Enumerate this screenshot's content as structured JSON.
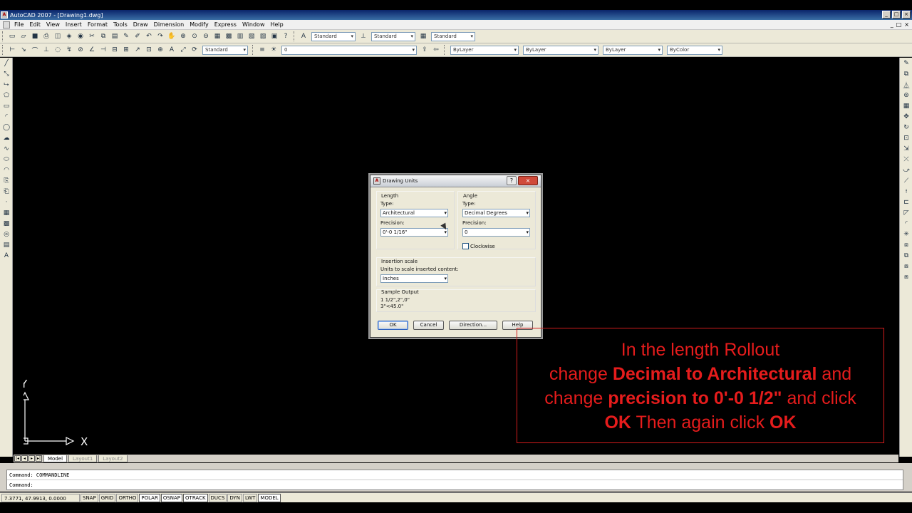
{
  "window": {
    "title": "AutoCAD 2007 - [Drawing1.dwg]",
    "app_icon": "autocad-icon",
    "controls": [
      "_",
      "□",
      "×"
    ],
    "mdi_controls": [
      "_",
      "□",
      "×"
    ]
  },
  "menu": {
    "items": [
      "File",
      "Edit",
      "View",
      "Insert",
      "Format",
      "Tools",
      "Draw",
      "Dimension",
      "Modify",
      "Express",
      "Window",
      "Help"
    ]
  },
  "toolbar1": {
    "text_style": "Standard",
    "dim_style": "Standard",
    "table_style": "Standard"
  },
  "toolbar2": {
    "dimstyle": "Standard",
    "layer": "0",
    "color": "ByLayer",
    "linetype": "ByLayer",
    "lineweight": "ByLayer",
    "plotstyle": "ByColor"
  },
  "ucs": {
    "x_label": "X",
    "y_label": "Y"
  },
  "layout_tabs": {
    "model": "Model",
    "layout1": "Layout1",
    "layout2": "Layout2"
  },
  "command": {
    "history": "Command: COMMANDLINE",
    "prompt": "Command:"
  },
  "status": {
    "coords": "7.3771, 47.9913, 0.0000",
    "buttons": [
      "SNAP",
      "GRID",
      "ORTHO",
      "POLAR",
      "OSNAP",
      "OTRACK",
      "DUCS",
      "DYN",
      "LWT",
      "MODEL"
    ]
  },
  "dialog": {
    "title": "Drawing Units",
    "help_icon": "?",
    "close_icon": "×",
    "length": {
      "group": "Length",
      "type_label": "Type:",
      "type_value": "Architectural",
      "precision_label": "Precision:",
      "precision_value": "0'-0 1/16\""
    },
    "angle": {
      "group": "Angle",
      "type_label": "Type:",
      "type_value": "Decimal Degrees",
      "precision_label": "Precision:",
      "precision_value": "0",
      "clockwise_label": "Clockwise"
    },
    "insertion": {
      "group": "Insertion scale",
      "label": "Units to scale inserted content:",
      "value": "Inches"
    },
    "sample": {
      "group": "Sample Output",
      "line1": "1 1/2\",2\",0\"",
      "line2": "3\"<45.0\""
    },
    "buttons": {
      "ok": "OK",
      "cancel": "Cancel",
      "direction": "Direction...",
      "help": "Help"
    }
  },
  "annotation": {
    "line1": "In the length Rollout",
    "line2_pre": "change ",
    "line2_bold": "Decimal to Architectural",
    "line2_post": " and",
    "line3_pre": "change ",
    "line3_bold": "precision to 0'-0 1/2\"",
    "line3_post": " and click",
    "line4_bold1": "OK",
    "line4_mid": " Then again click ",
    "line4_bold2": "OK"
  },
  "colors": {
    "annotation_red": "#e51c1c",
    "canvas": "#000000",
    "title_blue": "#0a246a"
  }
}
